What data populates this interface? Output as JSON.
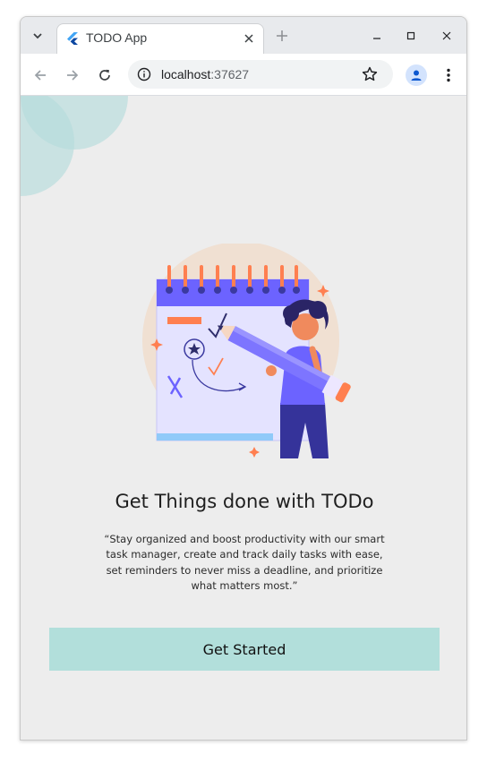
{
  "browser": {
    "tab_title": "TODO App",
    "url_host": "localhost",
    "url_port": ":37627"
  },
  "onboarding": {
    "headline": "Get Things done with TODo",
    "description": "“Stay organized and boost productivity with our smart task manager, create and track daily tasks with ease, set reminders to never miss a deadline, and prioritize what matters most.”",
    "cta_label": "Get Started"
  },
  "icons": {
    "tab_search": "chevron-down-icon",
    "favicon": "flutter-icon",
    "tab_close": "close-icon",
    "new_tab": "plus-icon",
    "minimize": "minimize-icon",
    "maximize": "maximize-icon",
    "close_window": "close-icon",
    "back": "arrow-left-icon",
    "forward": "arrow-right-icon",
    "reload": "reload-icon",
    "site_info": "info-icon",
    "bookmark": "star-icon",
    "profile": "person-icon",
    "menu": "kebab-menu-icon"
  },
  "colors": {
    "page_background": "#ededed",
    "cta_background": "#b2dfdb",
    "decor_circle": "#b5dcdc",
    "calendar_header": "#6c63ff",
    "accent_orange": "#ff7f50"
  }
}
